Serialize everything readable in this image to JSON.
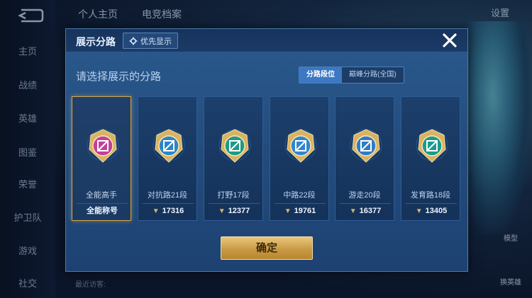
{
  "sidebar": {
    "items": [
      {
        "label": "主页"
      },
      {
        "label": "战绩"
      },
      {
        "label": "英雄"
      },
      {
        "label": "图鉴"
      },
      {
        "label": "荣誉"
      },
      {
        "label": "护卫队"
      },
      {
        "label": "游戏"
      },
      {
        "label": "社交"
      }
    ]
  },
  "topbar": {
    "tabs": [
      {
        "label": "个人主页"
      },
      {
        "label": "电竞档案"
      }
    ],
    "settings": "设置"
  },
  "background": {
    "visitor": "最近访客:",
    "hero_buttons": [
      {
        "label": "模型"
      },
      {
        "label": "换英雄"
      }
    ]
  },
  "dialog": {
    "title": "展示分路",
    "priority_label": "优先显示",
    "subtitle": "请选择展示的分路",
    "segments": [
      {
        "label": "分路段位",
        "active": true
      },
      {
        "label": "巅峰分路(全国)",
        "active": false
      }
    ],
    "cards": [
      {
        "name": "全能高手",
        "foot": "全能称号",
        "icon": "all-round-badge-icon",
        "selected": true,
        "color": "#c2409a"
      },
      {
        "name": "对抗路21段",
        "foot": "17316",
        "icon": "clash-lane-badge-icon",
        "selected": false,
        "color": "#2a86c8"
      },
      {
        "name": "打野17段",
        "foot": "12377",
        "icon": "jungle-badge-icon",
        "selected": false,
        "color": "#1e9a86"
      },
      {
        "name": "中路22段",
        "foot": "19761",
        "icon": "mid-lane-badge-icon",
        "selected": false,
        "color": "#2f86d0"
      },
      {
        "name": "游走20段",
        "foot": "16377",
        "icon": "roam-badge-icon",
        "selected": false,
        "color": "#2f7cc6"
      },
      {
        "name": "发育路18段",
        "foot": "13405",
        "icon": "farm-lane-badge-icon",
        "selected": false,
        "color": "#1b9a8e"
      }
    ],
    "confirm_label": "确定"
  }
}
